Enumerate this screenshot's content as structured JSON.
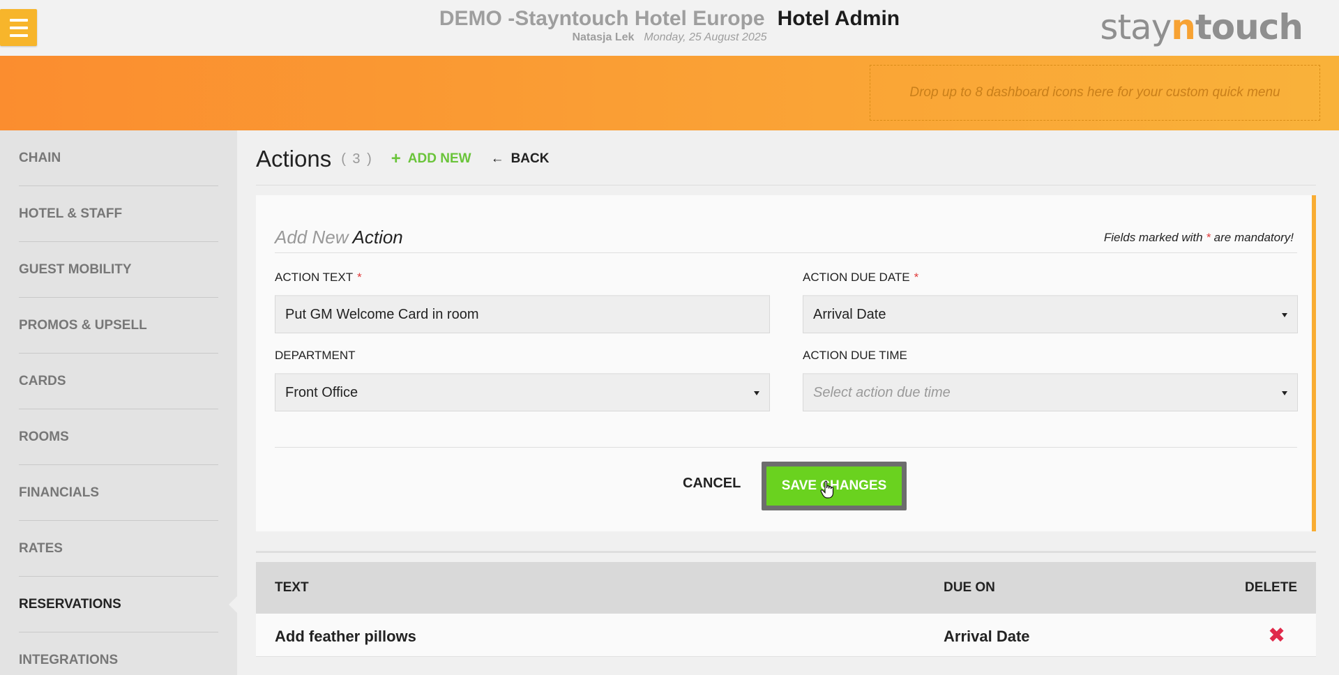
{
  "header": {
    "hotel_name": "DEMO -Stayntouch Hotel Europe",
    "app_name": "Hotel Admin",
    "user": "Natasja Lek",
    "date": "Monday, 25 August 2025",
    "logo_stay": "stay",
    "logo_n": "n",
    "logo_touch": "touch"
  },
  "quick_menu": {
    "dropzone_text": "Drop up to 8 dashboard icons here for your custom quick menu"
  },
  "sidebar": {
    "items": [
      {
        "label": "CHAIN"
      },
      {
        "label": "HOTEL & STAFF"
      },
      {
        "label": "GUEST MOBILITY"
      },
      {
        "label": "PROMOS & UPSELL"
      },
      {
        "label": "CARDS"
      },
      {
        "label": "ROOMS"
      },
      {
        "label": "FINANCIALS"
      },
      {
        "label": "RATES"
      },
      {
        "label": "RESERVATIONS"
      },
      {
        "label": "INTEGRATIONS"
      }
    ],
    "active": "RESERVATIONS"
  },
  "page": {
    "title": "Actions",
    "count": "( 3 )",
    "add_new": "ADD NEW",
    "back": "BACK"
  },
  "form": {
    "title_light": "Add New",
    "title_dark": "Action",
    "mandatory_prefix": "Fields marked with",
    "mandatory_star": "*",
    "mandatory_suffix": "are mandatory!",
    "action_text_label": "ACTION TEXT",
    "action_text_value": "Put GM Welcome Card in room",
    "due_date_label": "ACTION DUE DATE",
    "due_date_value": "Arrival Date",
    "department_label": "DEPARTMENT",
    "department_value": "Front Office",
    "due_time_label": "ACTION DUE TIME",
    "due_time_placeholder": "Select action due time",
    "required_star": "*",
    "cancel": "CANCEL",
    "save": "SAVE CHANGES"
  },
  "table": {
    "columns": [
      "TEXT",
      "DUE ON",
      "DELETE"
    ],
    "rows": [
      {
        "text": "Add feather pillows",
        "due_on": "Arrival Date",
        "delete_icon": "✖"
      }
    ]
  },
  "colors": {
    "accent_orange": "#f9ad33",
    "save_green": "#6ad21f",
    "add_green": "#6ac43a",
    "delete_red": "#e0294a"
  }
}
